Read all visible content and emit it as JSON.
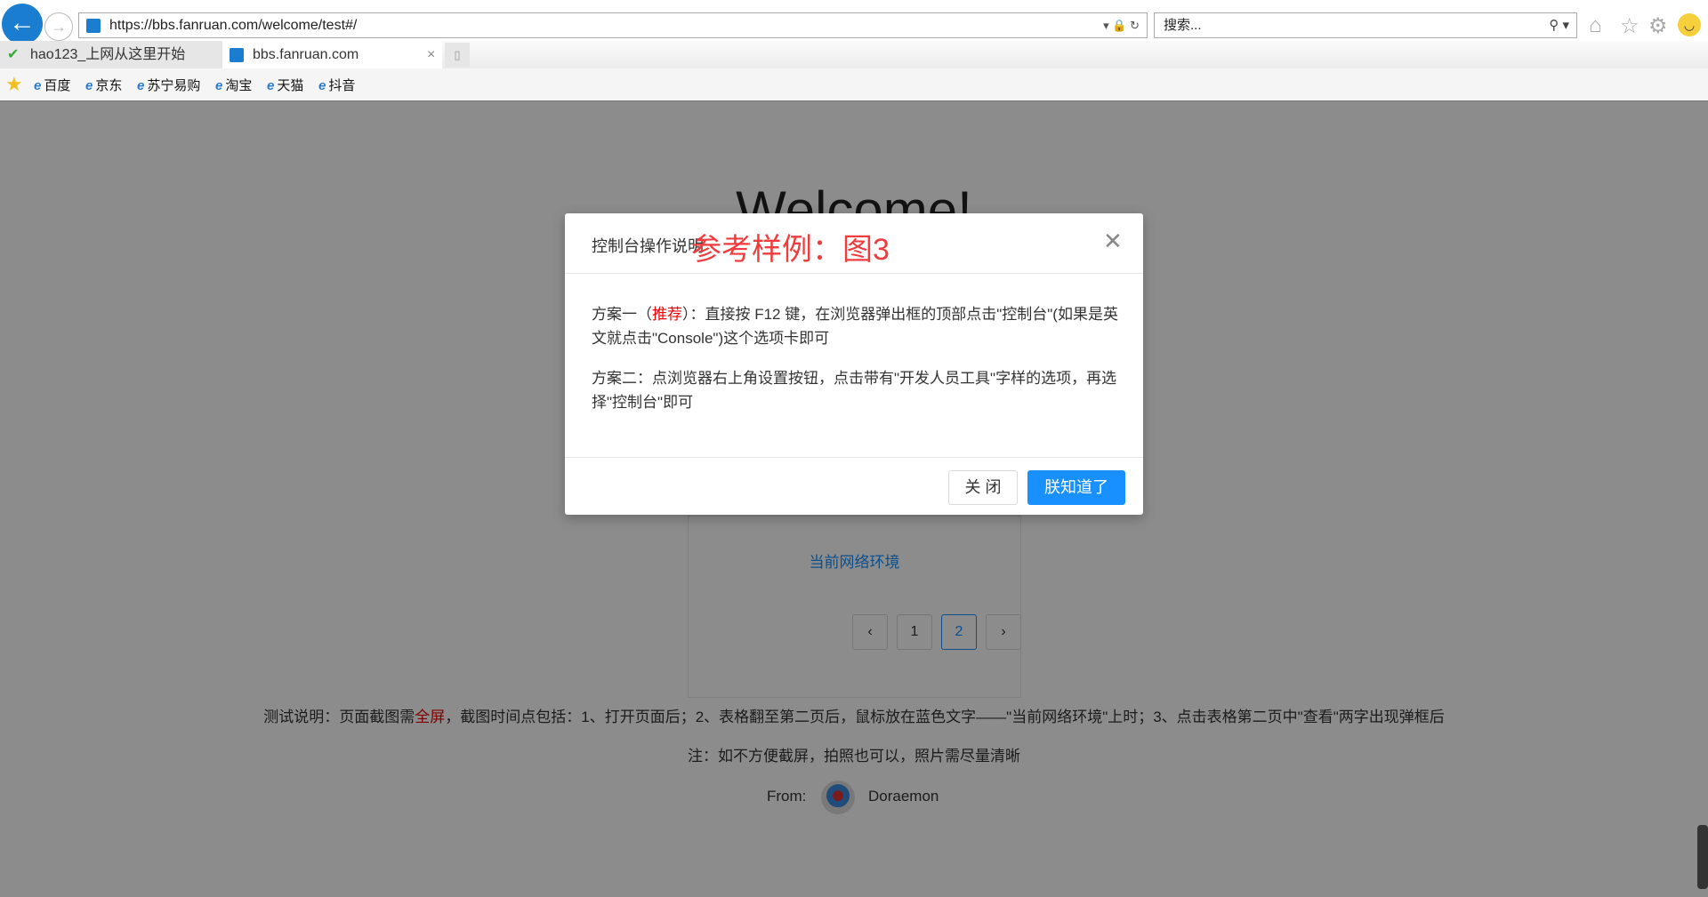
{
  "browser": {
    "url": "https://bbs.fanruan.com/welcome/test#/",
    "search_placeholder": "搜索...",
    "tabs": [
      {
        "label": "hao123_上网从这里开始",
        "active": false
      },
      {
        "label": "bbs.fanruan.com",
        "active": true
      }
    ],
    "favorites": [
      "百度",
      "京东",
      "苏宁易购",
      "淘宝",
      "天猫",
      "抖音"
    ]
  },
  "page": {
    "welcome": "Welcome!",
    "network_link": "当前网络环境",
    "pagination": {
      "prev": "‹",
      "pages": [
        "1",
        "2"
      ],
      "current": "2",
      "next": "›"
    },
    "instructions": {
      "prefix": "测试说明：页面截图需",
      "highlight": "全屏",
      "suffix": "，截图时间点包括：1、打开页面后；2、表格翻至第二页后，鼠标放在蓝色文字——\"当前网络环境\"上时；3、点击表格第二页中\"查看\"两字出现弹框后"
    },
    "note": "注：如不方便截屏，拍照也可以，照片需尽量清晰",
    "from_label": "From:",
    "author": "Doraemon"
  },
  "modal": {
    "title": "控制台操作说明",
    "sample_label": "参考样例：图3",
    "option1_prefix": "方案一（",
    "option1_highlight": "推荐",
    "option1_suffix": "）：直接按 F12 键，在浏览器弹出框的顶部点击\"控制台\"(如果是英文就点击\"Console\")这个选项卡即可",
    "option2": "方案二：点浏览器右上角设置按钮，点击带有\"开发人员工具\"字样的选项，再选择\"控制台\"即可",
    "close_label": "关 闭",
    "ok_label": "朕知道了"
  }
}
